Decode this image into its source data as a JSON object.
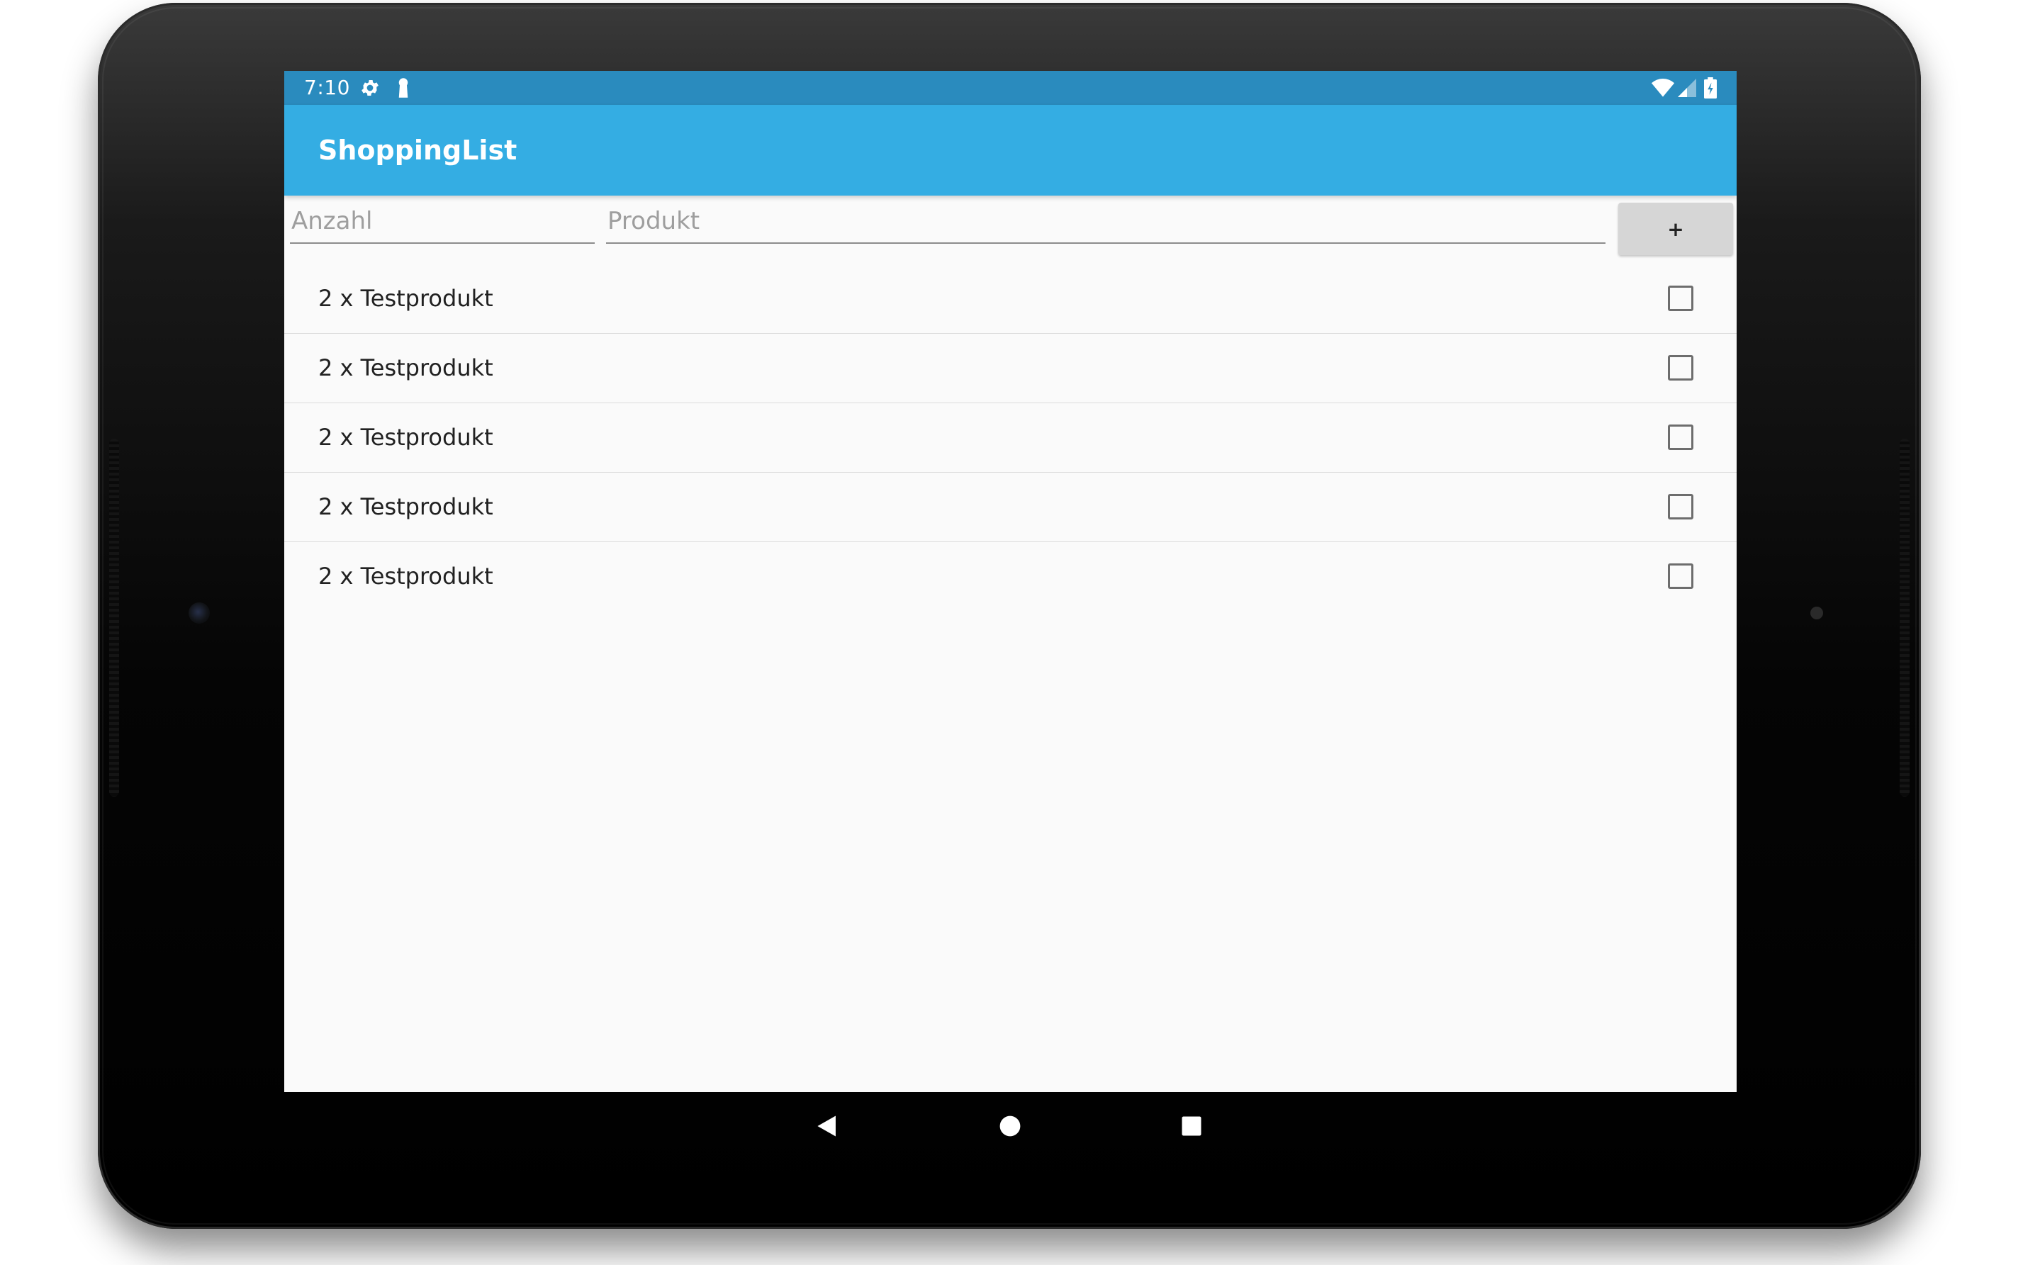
{
  "status_bar": {
    "time": "7:10",
    "left_icons": [
      "gear-icon",
      "keyhole-icon"
    ],
    "right_icons": [
      "wifi-icon",
      "cellular-signal-icon",
      "battery-charging-icon"
    ]
  },
  "app_bar": {
    "title": "ShoppingList"
  },
  "input_row": {
    "quantity_placeholder": "Anzahl",
    "product_placeholder": "Produkt",
    "add_button_label": "+"
  },
  "list": {
    "items": [
      {
        "label": "2 x Testprodukt",
        "checked": false
      },
      {
        "label": "2 x Testprodukt",
        "checked": false
      },
      {
        "label": "2 x Testprodukt",
        "checked": false
      },
      {
        "label": "2 x Testprodukt",
        "checked": false
      },
      {
        "label": "2 x Testprodukt",
        "checked": false
      }
    ]
  },
  "nav_bar": {
    "buttons": [
      "back-icon",
      "home-icon",
      "recents-icon"
    ]
  },
  "colors": {
    "status_bar": "#2a8bbe",
    "app_bar": "#34ade3",
    "background": "#fafafa",
    "button": "#d6d6d6"
  }
}
